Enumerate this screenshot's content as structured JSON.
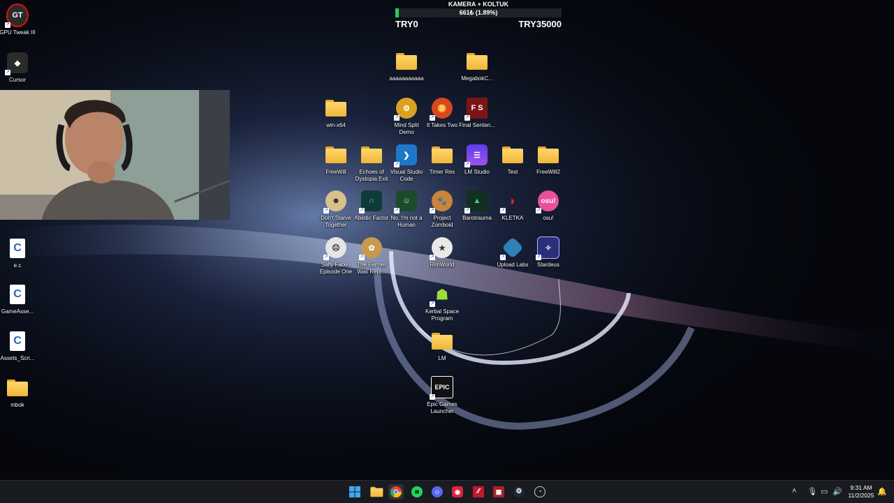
{
  "progress_widget": {
    "title": "KAMERA + KOLTUK",
    "amount_text": "661₺ (1.89%)",
    "progress_fraction": 0.0189,
    "min_label": "TRY0",
    "max_label": "TRY35000",
    "fill_color": "#20d05a"
  },
  "desktop_icons": {
    "gpu_tweak": "GPU Tweak III",
    "cursor": "Cursor",
    "ec": "e.c",
    "gameassets": "GameAsse...",
    "assets_scripts": "Assets_Scri...",
    "mbok": "mbok",
    "aaaa": "aaaaaaaaaaa",
    "megabok": "MegabokC...",
    "winx64": "win-x64",
    "mind_split": "Mind Split Demo",
    "it_takes_two": "It Takes Two",
    "final_sentence": "Final Senten...",
    "freewill": "FreeWill",
    "echoes": "Echoes of Dystopia Exit",
    "vscode": "Visual Studio Code",
    "timer_res": "Timer Res",
    "lm_studio": "LM Studio",
    "test": "Test",
    "freewill2": "FreeWill2",
    "dont_starve": "Don't Starve Together",
    "abiotic": "Abiotic Factor",
    "no_im_not_human": "No, I'm not a Human",
    "project_zomboid": "Project Zomboid",
    "barotrauma": "Barotrauma",
    "kletka": "KLETKA",
    "osu": "osu!",
    "sally_face": "Sally Face - Episode One",
    "farmer": "The Farmer Was Repl...",
    "rimworld": "RimWorld",
    "upload_labs": "Upload Labs",
    "stardeus": "Stardeus",
    "ksp": "Kerbal Space Program",
    "lm": "LM",
    "epic": "Epic Games Launcher"
  },
  "taskbar": {
    "time": "9:31 AM",
    "date": "11/2/2025"
  },
  "icon_text": {
    "fs": "F S",
    "osu": "osu!",
    "epic": "EPIC",
    "gpu": "GT",
    "c": "C"
  }
}
